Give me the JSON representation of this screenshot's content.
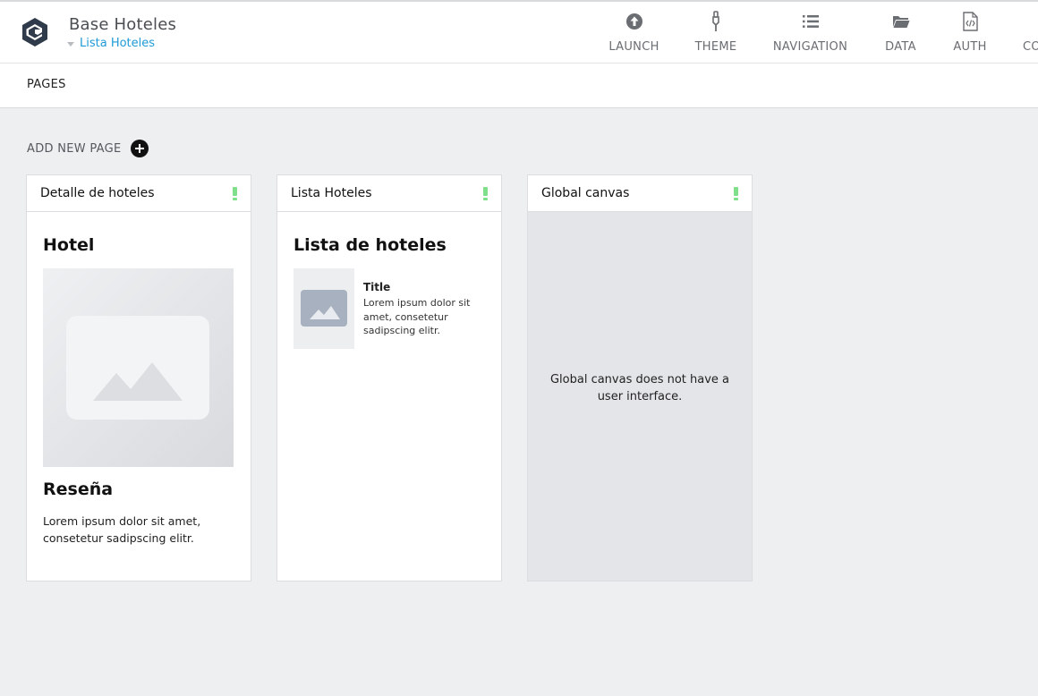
{
  "header": {
    "app_title": "Base Hoteles",
    "current_page": "Lista Hoteles"
  },
  "nav": [
    {
      "label": "LAUNCH",
      "icon": "launch-icon"
    },
    {
      "label": "THEME",
      "icon": "brush-icon"
    },
    {
      "label": "NAVIGATION",
      "icon": "list-icon"
    },
    {
      "label": "DATA",
      "icon": "folder-icon"
    },
    {
      "label": "AUTH",
      "icon": "code-file-icon"
    },
    {
      "label": "CO",
      "icon": ""
    }
  ],
  "subbar": {
    "pages_label": "PAGES"
  },
  "add_page": {
    "label": "ADD NEW PAGE",
    "icon": "plus-circle-icon"
  },
  "colors": {
    "accent": "#1e9ad6",
    "status": "#7ee08a",
    "background": "#eeeff1"
  },
  "cards": [
    {
      "name": "Detalle de hoteles",
      "preview": {
        "title": "Hotel",
        "image_icon": "image-placeholder-icon",
        "heading": "Reseña",
        "body": "Lorem ipsum dolor sit amet, consetetur sadipscing elitr."
      }
    },
    {
      "name": "Lista Hoteles",
      "preview": {
        "title": "Lista de hoteles",
        "item_title": "Title",
        "item_body": "Lorem ipsum dolor sit amet, consetetur sadipscing elitr."
      }
    },
    {
      "name": "Global canvas",
      "preview": {
        "message": "Global canvas does not have a user interface."
      }
    }
  ]
}
